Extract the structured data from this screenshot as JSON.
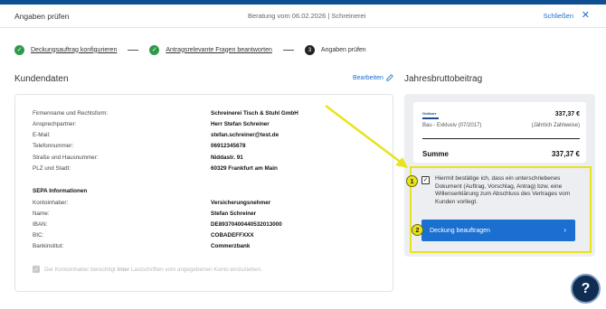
{
  "header": {
    "title": "Angaben prüfen",
    "center": "Beratung vom 06.02.2026 | Schreinerei",
    "close_label": "Schließen",
    "close_icon": "✕"
  },
  "steps": [
    {
      "label": "Deckungsauftrag konfigurieren",
      "state": "done"
    },
    {
      "label": "Antragsrelevante Fragen beantworten",
      "state": "done"
    },
    {
      "number": "3",
      "label": "Angaben prüfen",
      "state": "active"
    }
  ],
  "customer": {
    "section_title": "Kundendaten",
    "edit_label": "Bearbeiten",
    "fields": [
      {
        "label": "Firmenname und Rechtsform:",
        "value": "Schreinerei Tisch & Stuhl GmbH"
      },
      {
        "label": "Ansprechpartner:",
        "value": "Herr Stefan Schreiner"
      },
      {
        "label": "E-Mail:",
        "value": "stefan.schreiner@test.de"
      },
      {
        "label": "Telefonnummer:",
        "value": "06912345678"
      },
      {
        "label": "Straße und Hausnummer:",
        "value": "Niddastr. 91"
      },
      {
        "label": "PLZ und Stadt:",
        "value": "60329 Frankfurt am Main"
      }
    ],
    "sepa_title": "SEPA Informationen",
    "sepa_fields": [
      {
        "label": "Kontoinhaber:",
        "value": "Versicherungsnehmer"
      },
      {
        "label": "Name:",
        "value": "Stefan Schreiner"
      },
      {
        "label": "IBAN:",
        "value": "DE89370400440532013000"
      },
      {
        "label": "BIC:",
        "value": "COBADEFFXXX"
      },
      {
        "label": "Bankinstitut:",
        "value": "Commerzbank"
      }
    ],
    "consent_pre": "Der Kontoinhaber berechtigt",
    "consent_strong": "Inter",
    "consent_post": "Lastschriften vom angegebenen Konto einzuziehen."
  },
  "premium": {
    "section_title": "Jahresbruttobeitrag",
    "logo_text": "Gothaer",
    "price": "337,37 €",
    "tariff": "Bau - Exklusiv (07/2017)",
    "rhythm": "(Jährlich Zahlweise)",
    "sum_label": "Summe",
    "sum_value": "337,37 €",
    "confirm_text": "Hiermit bestätige ich, dass ein unterschriebenes Dokument (Auftrag, Vorschlag, Antrag) bzw. eine Willenserklärung zum Abschluss des Vertrages vom Kunden vorliegt.",
    "confirm_checked": true,
    "cta_label": "Deckung beauftragen",
    "cta_icon": "›"
  },
  "annotations": {
    "badge1": "1",
    "badge2": "2",
    "highlight_color": "#e8e31a"
  },
  "help": {
    "label": "?"
  },
  "colors": {
    "brand_blue": "#1a6fd1",
    "dark_navy": "#0f2c52",
    "success_green": "#2e9b4a"
  }
}
